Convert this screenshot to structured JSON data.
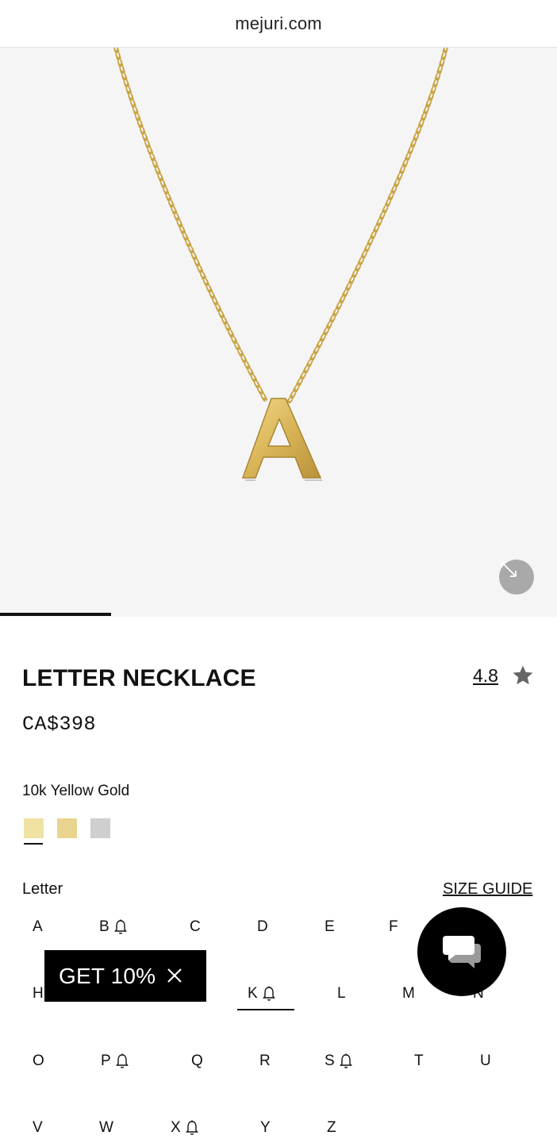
{
  "browser": {
    "url": "mejuri.com"
  },
  "gallery": {
    "progress": 0.2
  },
  "product": {
    "title": "LETTER NECKLACE",
    "rating": "4.8",
    "price": "CA$398",
    "material": "10k Yellow Gold",
    "swatch_colors": [
      "#f0e2a3",
      "#e9d48f",
      "#cfcfcf"
    ]
  },
  "letters": {
    "label": "Letter",
    "size_guide": "SIZE GUIDE",
    "items": [
      {
        "l": "A",
        "bell": false
      },
      {
        "l": "B",
        "bell": true
      },
      {
        "l": "C",
        "bell": false
      },
      {
        "l": "D",
        "bell": false
      },
      {
        "l": "E",
        "bell": false
      },
      {
        "l": "F",
        "bell": false
      },
      {
        "l": "H",
        "bell": false
      },
      {
        "l": "K",
        "bell": true
      },
      {
        "l": "L",
        "bell": false
      },
      {
        "l": "M",
        "bell": false
      },
      {
        "l": "N",
        "bell": false
      },
      {
        "l": "O",
        "bell": false
      },
      {
        "l": "P",
        "bell": true
      },
      {
        "l": "Q",
        "bell": false
      },
      {
        "l": "R",
        "bell": false
      },
      {
        "l": "S",
        "bell": true
      },
      {
        "l": "T",
        "bell": false
      },
      {
        "l": "U",
        "bell": false
      },
      {
        "l": "V",
        "bell": false
      },
      {
        "l": "W",
        "bell": false
      },
      {
        "l": "X",
        "bell": true
      },
      {
        "l": "Y",
        "bell": false
      },
      {
        "l": "Z",
        "bell": false
      }
    ],
    "selected": "K"
  },
  "promo": {
    "text": "GET 10%"
  }
}
